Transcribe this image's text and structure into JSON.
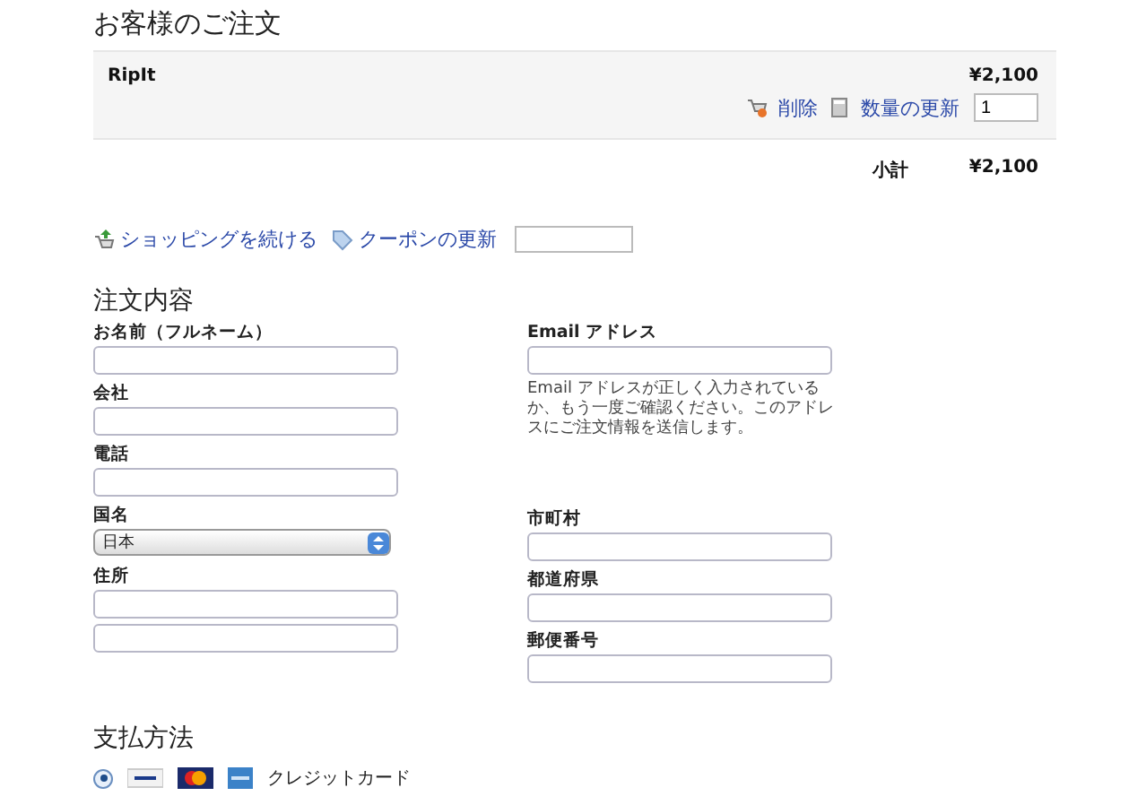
{
  "cart": {
    "title": "お客様のご注文",
    "items": [
      {
        "name": "RipIt",
        "price": "¥2,100",
        "remove": "削除",
        "update": "数量の更新",
        "quantity": "1"
      }
    ],
    "subtotal": {
      "label": "小計",
      "value": "¥2,100"
    }
  },
  "links": {
    "continue": "ショッピングを続ける",
    "coupon": "クーポンの更新"
  },
  "order": {
    "title": "注文内容",
    "left": [
      {
        "kind": "text",
        "label": "お名前（フルネーム）"
      },
      {
        "kind": "text",
        "label": "会社"
      },
      {
        "kind": "text",
        "label": "電話"
      },
      {
        "kind": "select",
        "label": "国名",
        "value": "日本"
      },
      {
        "kind": "address",
        "label": "住所"
      }
    ],
    "right": [
      {
        "kind": "text",
        "label": "Email アドレス",
        "help": "Email アドレスが正しく入力されているか、もう一度ご確認ください。このアドレスにご注文情報を送信します。"
      },
      {
        "kind": "text",
        "label": "市町村"
      },
      {
        "kind": "text",
        "label": "都道府県"
      },
      {
        "kind": "text",
        "label": "郵便番号"
      }
    ]
  },
  "payment": {
    "title": "支払方法",
    "methods": [
      {
        "label": "クレジットカード",
        "selected": true
      }
    ]
  }
}
